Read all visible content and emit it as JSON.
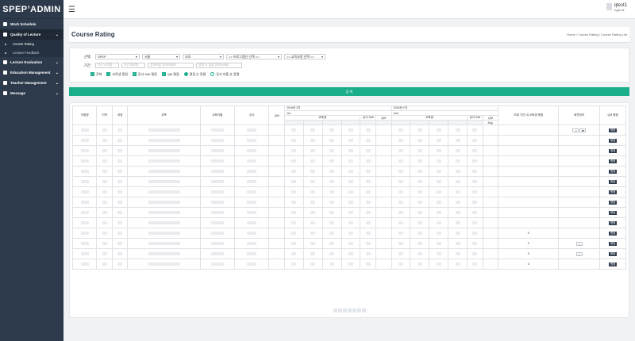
{
  "brand": "SPEP’ADMIN",
  "user": {
    "name": "qtest1",
    "sub": "login at"
  },
  "nav": [
    {
      "label": "Work Schedule",
      "icon": "document-icon",
      "open": false,
      "chev": ""
    },
    {
      "label": "Quality of Lecture",
      "icon": "star-icon",
      "open": true,
      "chev": "⌄",
      "sub": [
        "Course Rating",
        "Lecture Feedback"
      ]
    },
    {
      "label": "Lecture Evaluation",
      "icon": "clipboard-icon",
      "open": false,
      "chev": "⌄"
    },
    {
      "label": "Education Management",
      "icon": "book-icon",
      "open": false,
      "chev": "⌄"
    },
    {
      "label": "Teacher Management",
      "icon": "user-icon",
      "open": false,
      "chev": "⌄"
    },
    {
      "label": "Message",
      "icon": "message-icon",
      "open": false,
      "chev": "⌄"
    }
  ],
  "page": {
    "title": "Course Rating",
    "breadcrumb": "Home  /  Course Rating  /  Course Rating List"
  },
  "filters": {
    "label_select": "선택",
    "label_period": "기간",
    "sel1": "SPEP",
    "sel2": "서울",
    "sel3": "조모",
    "sel4": "== 프로그램선 선택 ==",
    "sel5": "== 교육과정 선택 ==",
    "date_start": "기간 시작일",
    "date_end": "기간 종료일",
    "in3": "검색어를 입력하세요",
    "in4": "명칭 또 명을 입력하세요",
    "checks": [
      "전체",
      "교육생 평점",
      "강사 Self 평점",
      "QM 평점"
    ],
    "radios": [
      "평점 순 정렬",
      "강사 미흡 순 정렬"
    ],
    "search": "검 색"
  },
  "table": {
    "headers": [
      "지점명",
      "지역",
      "과정",
      "과목",
      "교육차월",
      "강사",
      "QM"
    ],
    "group1": "2016년 2차",
    "group2": "2016년 1차",
    "sub1": "1st",
    "sub2": "2nd",
    "col_trainee": "교육생",
    "col_self": "강사 Self",
    "col_qm": "QM",
    "col_avg": "Avg.",
    "col_count": "조회 기간 내 교육생 평점",
    "col_video": "화면강의",
    "col_qm_eval": "QM 평점",
    "btn_eval": "평점",
    "count_values": [
      "0",
      "0",
      "0",
      "0"
    ]
  }
}
